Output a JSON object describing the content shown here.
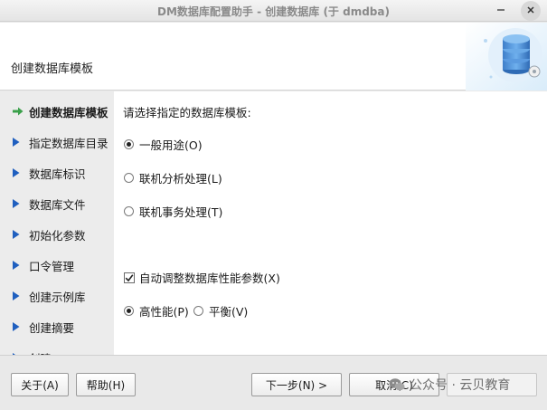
{
  "window": {
    "title": "DM数据库配置助手 - 创建数据库 (于 dmdba)"
  },
  "header": {
    "heading": "创建数据库模板"
  },
  "sidebar": {
    "items": [
      {
        "label": "创建数据库模板",
        "active": true
      },
      {
        "label": "指定数据库目录"
      },
      {
        "label": "数据库标识"
      },
      {
        "label": "数据库文件"
      },
      {
        "label": "初始化参数"
      },
      {
        "label": "口令管理"
      },
      {
        "label": "创建示例库"
      },
      {
        "label": "创建摘要"
      },
      {
        "label": "创建"
      }
    ]
  },
  "main": {
    "prompt": "请选择指定的数据库模板:",
    "templates": [
      {
        "label": "一般用途(O)",
        "selected": true
      },
      {
        "label": "联机分析处理(L)",
        "selected": false
      },
      {
        "label": "联机事务处理(T)",
        "selected": false
      }
    ],
    "auto_tune": {
      "label": "自动调整数据库性能参数(X)",
      "checked": true
    },
    "performance": [
      {
        "label": "高性能(P)",
        "selected": true
      },
      {
        "label": "平衡(V)",
        "selected": false
      }
    ]
  },
  "footer": {
    "about": "关于(A)",
    "help": "帮助(H)",
    "next": "下一步(N) >",
    "cancel": "取消(C)",
    "finish": ""
  },
  "watermark": "公众号 · 云贝教育",
  "colors": {
    "nav_arrow": "#1f5fbf",
    "active_arrow": "#3aa04a"
  }
}
